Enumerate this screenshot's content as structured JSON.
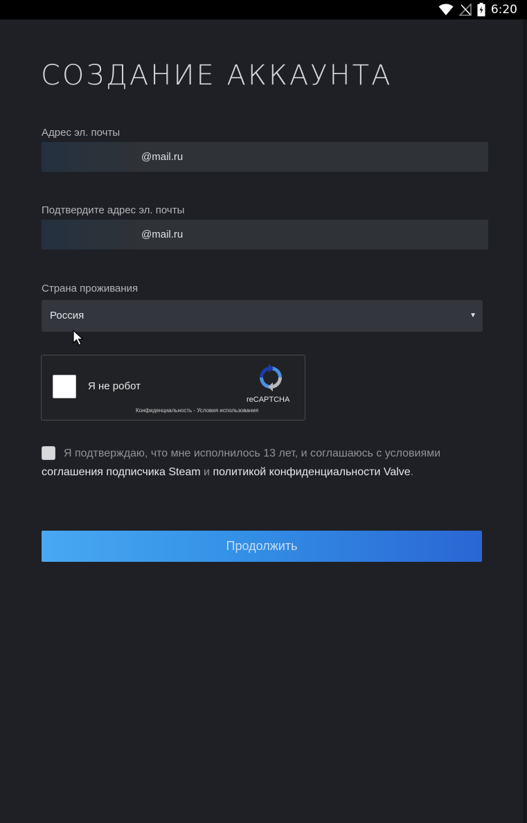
{
  "status_bar": {
    "time": "6:20",
    "icons": [
      "wifi-icon",
      "signal-icon",
      "battery-icon"
    ]
  },
  "form": {
    "title": "СОЗДАНИЕ АККАУНТА",
    "email": {
      "label": "Адрес эл. почты",
      "value": "@mail.ru"
    },
    "email_confirm": {
      "label": "Подтвердите адрес эл. почты",
      "value": "@mail.ru"
    },
    "country": {
      "label": "Страна проживания",
      "selected": "Россия",
      "arrow": "▼"
    },
    "recaptcha": {
      "label": "Я не робот",
      "brand": "reCAPTCHA",
      "links": "Конфиденциальность - Условия использования"
    },
    "agreement": {
      "text_1": "Я подтверждаю, что мне исполнилось 13 лет, и соглашаюсь с условиями",
      "link_1": "соглашения подписчика Steam",
      "text_2": "и",
      "link_2": "политикой конфиденциальности Valve",
      "text_3": "."
    },
    "continue_label": "Продолжить"
  },
  "colors": {
    "background": "#1f2025",
    "field_background": "#2f3237",
    "button_gradient_start": "#49a8f2",
    "button_gradient_end": "#2a66d4"
  }
}
